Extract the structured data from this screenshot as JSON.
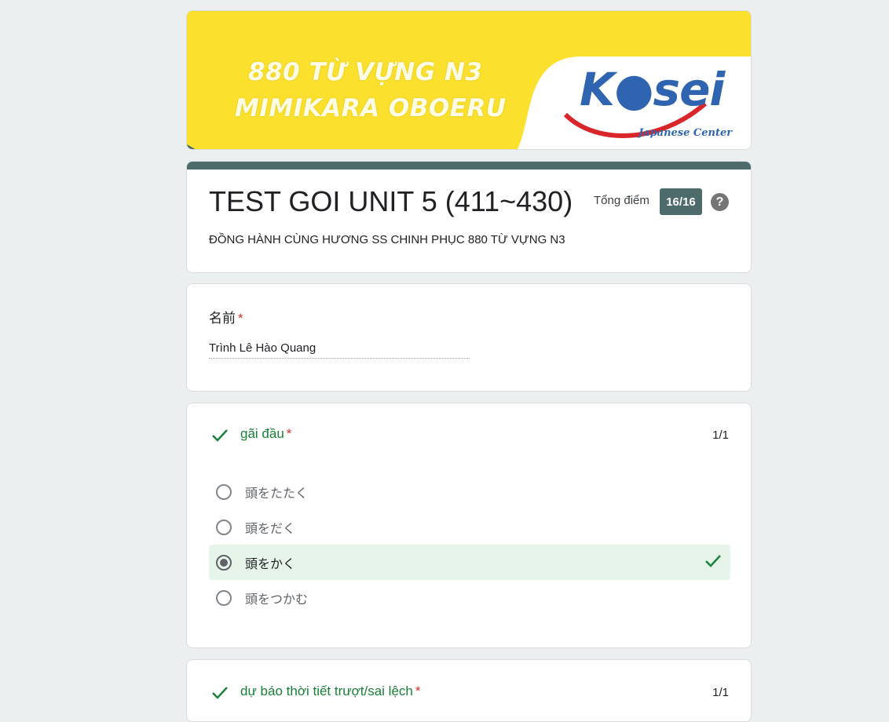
{
  "banner": {
    "line1": "880 TỪ VỰNG N3",
    "line2": "MIMIKARA OBOERU",
    "logo_word": "K●sei",
    "logo_sub": "Japanese Center"
  },
  "header": {
    "title": "TEST GOI UNIT 5 (411~430)",
    "description": "ĐỒNG HÀNH CÙNG HƯƠNG SS CHINH PHỤC 880 TỪ VỰNG N3",
    "score_label": "Tổng điểm",
    "score_value": "16/16",
    "help_glyph": "?"
  },
  "name_question": {
    "label": "名前",
    "required_mark": "*",
    "answer": "Trình Lê Hào Quang"
  },
  "question1": {
    "title": "gãi đầu",
    "required_mark": "*",
    "points": "1/1",
    "options": [
      {
        "label": "頭をたたく",
        "selected": false,
        "correct": false
      },
      {
        "label": "頭をだく",
        "selected": false,
        "correct": false
      },
      {
        "label": "頭をかく",
        "selected": true,
        "correct": true
      },
      {
        "label": "頭をつかむ",
        "selected": false,
        "correct": false
      }
    ]
  },
  "question2": {
    "title": "dự báo thời tiết trượt/sai lệch",
    "required_mark": "*",
    "points": "1/1"
  },
  "colors": {
    "theme": "#4e6b6c",
    "correct_green": "#188038",
    "correct_bg": "#e6f4ea",
    "required_red": "#d93025",
    "page_bg": "#ebeff0",
    "banner_yellow": "#fbe02e"
  },
  "icons": [
    "check-icon",
    "help-icon",
    "radio-icon"
  ]
}
